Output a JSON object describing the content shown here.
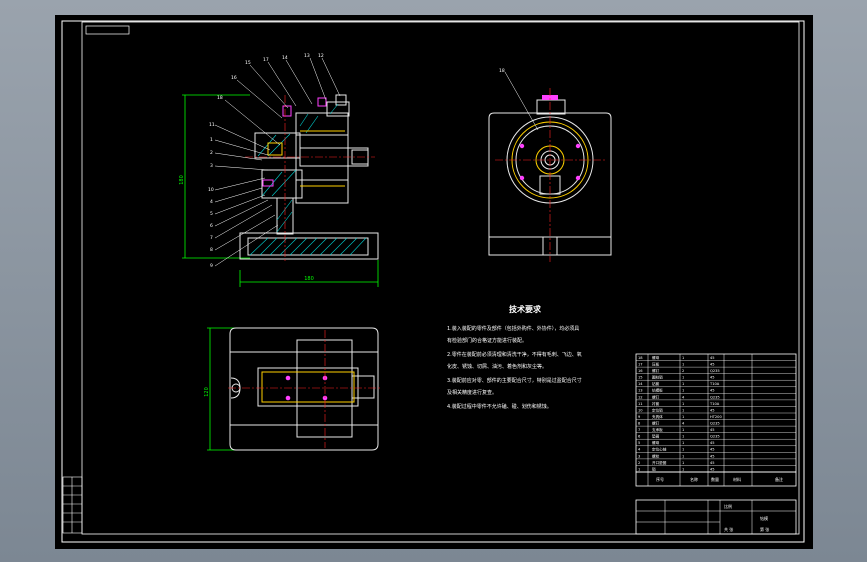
{
  "viewer": {
    "background_top": "#9aa3ad",
    "background_bottom": "#7c8793",
    "canvas_color": "#000000"
  },
  "drawing": {
    "line_colors": {
      "frame": "#ffffff",
      "dimension": "#00ff00",
      "centerline": "#ff2020",
      "part": "#e8e8e8",
      "hatch": "#00cccc",
      "leader": "#ffffff",
      "accent_yellow": "#ffd000",
      "accent_magenta": "#ff40ff"
    },
    "views": [
      "front-section-view",
      "side-view",
      "top-view"
    ],
    "balloons_front_view": [
      "18",
      "16",
      "15",
      "17",
      "14",
      "13",
      "12",
      "11",
      "1",
      "2",
      "3",
      "10",
      "4",
      "5",
      "6",
      "7",
      "8",
      "9"
    ],
    "balloon_side_view": "18",
    "dimension_values": {
      "front_height": "180",
      "front_width": "180",
      "top_height": "120"
    }
  },
  "tech_notes": {
    "title": "技术要求",
    "items": [
      "1.装入装配的零件及部件（包括外购件、外协件），均必须具",
      "有检验部门的合格证方能进行装配。",
      "2.零件在装配前必须清理和清洗干净，不得有毛刺、飞边、氧",
      "化皮、锈蚀、切屑、油污、着色剂和灰尘等。",
      "3.装配前应对零、部件的主要配合尺寸，特别是过盈配合尺寸",
      "及相关精度进行复查。",
      "4.装配过程中零件不允许磕、碰、划伤和锈蚀。"
    ]
  },
  "parts_list": {
    "row_count": 18,
    "header_labels": [
      "序号",
      "名称",
      "数量",
      "材料",
      "备注"
    ],
    "rows": [
      [
        "18",
        "螺母",
        "1",
        "45",
        ""
      ],
      [
        "17",
        "压板",
        "1",
        "45",
        ""
      ],
      [
        "16",
        "螺钉",
        "2",
        "Q235",
        ""
      ],
      [
        "15",
        "圆柱销",
        "1",
        "45",
        ""
      ],
      [
        "14",
        "钻套",
        "1",
        "T10A",
        ""
      ],
      [
        "13",
        "钻模板",
        "1",
        "45",
        ""
      ],
      [
        "12",
        "螺钉",
        "4",
        "Q235",
        ""
      ],
      [
        "11",
        "衬套",
        "1",
        "T10A",
        ""
      ],
      [
        "10",
        "定位销",
        "1",
        "45",
        ""
      ],
      [
        "9",
        "夹具体",
        "1",
        "HT200",
        ""
      ],
      [
        "8",
        "螺钉",
        "4",
        "Q235",
        ""
      ],
      [
        "7",
        "支承板",
        "1",
        "45",
        ""
      ],
      [
        "6",
        "垫圈",
        "1",
        "Q235",
        ""
      ],
      [
        "5",
        "螺母",
        "1",
        "45",
        ""
      ],
      [
        "4",
        "定位心轴",
        "1",
        "45",
        ""
      ],
      [
        "3",
        "螺栓",
        "1",
        "45",
        ""
      ],
      [
        "2",
        "开口垫圈",
        "1",
        "45",
        ""
      ],
      [
        "1",
        "销",
        "1",
        "45",
        ""
      ]
    ]
  },
  "title_block": {
    "label_1": "比例",
    "label_2": "钻模",
    "label_3": "共 张",
    "label_4": "第 张"
  }
}
